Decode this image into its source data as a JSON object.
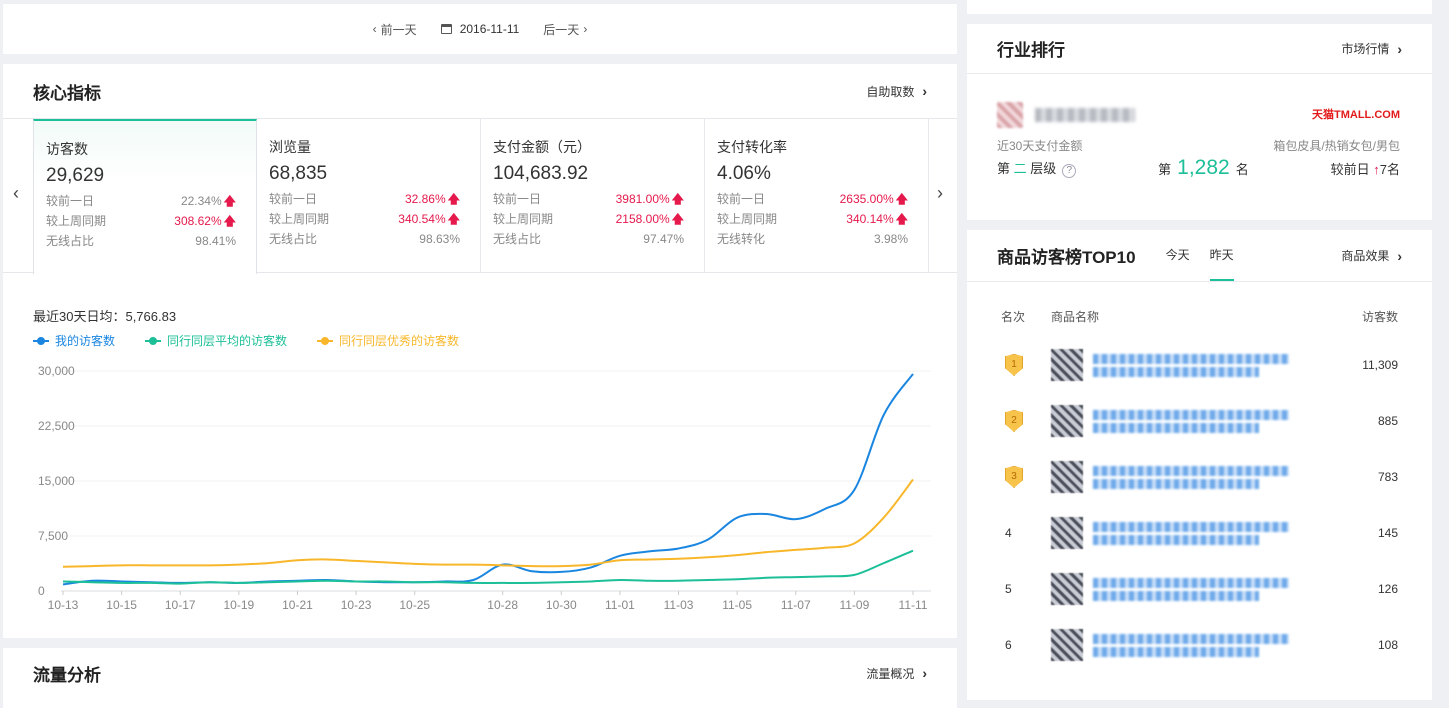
{
  "datebar": {
    "prev": "前一天",
    "date": "2016-11-11",
    "next": "后一天"
  },
  "core": {
    "title": "核心指标",
    "link": "自助取数",
    "metrics": [
      {
        "title": "访客数",
        "value": "29,629",
        "rows": [
          {
            "label": "较前一日",
            "value": "22.34%",
            "up": false
          },
          {
            "label": "较上周同期",
            "value": "308.62%",
            "up": true
          },
          {
            "label": "无线占比",
            "value": "98.41%",
            "up": null
          }
        ]
      },
      {
        "title": "浏览量",
        "value": "68,835",
        "rows": [
          {
            "label": "较前一日",
            "value": "32.86%",
            "up": true
          },
          {
            "label": "较上周同期",
            "value": "340.54%",
            "up": true
          },
          {
            "label": "无线占比",
            "value": "98.63%",
            "up": null
          }
        ]
      },
      {
        "title": "支付金额（元）",
        "value": "104,683.92",
        "rows": [
          {
            "label": "较前一日",
            "value": "3981.00%",
            "up": true
          },
          {
            "label": "较上周同期",
            "value": "2158.00%",
            "up": true
          },
          {
            "label": "无线占比",
            "value": "97.47%",
            "up": null
          }
        ]
      },
      {
        "title": "支付转化率",
        "value": "4.06%",
        "rows": [
          {
            "label": "较前一日",
            "value": "2635.00%",
            "up": true
          },
          {
            "label": "较上周同期",
            "value": "340.14%",
            "up": true
          },
          {
            "label": "无线转化",
            "value": "3.98%",
            "up": null
          }
        ]
      }
    ],
    "avg_label": "最近30天日均：5,766.83"
  },
  "chart_data": {
    "type": "line",
    "ylim": [
      0,
      30000
    ],
    "yticks": [
      "30,000",
      "22,500",
      "15,000",
      "7,500",
      "0"
    ],
    "ytick_values": [
      30000,
      22500,
      15000,
      7500,
      0
    ],
    "x": [
      "10-13",
      "10-14",
      "10-15",
      "10-16",
      "10-17",
      "10-18",
      "10-19",
      "10-20",
      "10-21",
      "10-22",
      "10-23",
      "10-24",
      "10-25",
      "10-26",
      "10-27",
      "10-28",
      "10-29",
      "10-30",
      "10-31",
      "11-01",
      "11-02",
      "11-03",
      "11-04",
      "11-05",
      "11-06",
      "11-07",
      "11-08",
      "11-09",
      "11-10",
      "11-11"
    ],
    "xtick_labels": [
      "10-13",
      "10-15",
      "10-17",
      "10-19",
      "10-21",
      "10-23",
      "10-25",
      "10-28",
      "10-30",
      "11-01",
      "11-03",
      "11-05",
      "11-07",
      "11-09",
      "11-11"
    ],
    "series": [
      {
        "name": "我的访客数",
        "color": "#1a86e0",
        "values": [
          900,
          1400,
          1300,
          1200,
          1100,
          1200,
          1100,
          1300,
          1400,
          1500,
          1300,
          1200,
          1200,
          1300,
          1500,
          3600,
          2700,
          2600,
          3200,
          4800,
          5400,
          5800,
          7000,
          10000,
          10500,
          9800,
          11200,
          13800,
          24000,
          29600
        ]
      },
      {
        "name": "同行同层平均的访客数",
        "color": "#1cbf98",
        "values": [
          1300,
          1200,
          1100,
          1100,
          1000,
          1200,
          1100,
          1200,
          1300,
          1400,
          1300,
          1300,
          1200,
          1200,
          1100,
          1100,
          1100,
          1200,
          1300,
          1500,
          1400,
          1400,
          1500,
          1600,
          1800,
          1900,
          2000,
          2200,
          3800,
          5500
        ]
      },
      {
        "name": "同行同层优秀的访客数",
        "color": "#f8b72a",
        "values": [
          3300,
          3400,
          3500,
          3500,
          3500,
          3500,
          3600,
          3800,
          4200,
          4300,
          4100,
          3900,
          3700,
          3600,
          3600,
          3500,
          3400,
          3400,
          3600,
          4200,
          4300,
          4400,
          4600,
          4900,
          5300,
          5600,
          5900,
          6500,
          10000,
          15200
        ]
      }
    ]
  },
  "flow": {
    "title": "流量分析",
    "link": "流量概况"
  },
  "rank": {
    "title": "行业排行",
    "link": "市场行情",
    "tmall": "天猫TMALL.COM",
    "sub_left": "近30天支付金额",
    "sub_right": "箱包皮具/热销女包/男包",
    "level_prefix": "第",
    "level_num": "二",
    "level_suffix": "层级",
    "rank_prefix": "第",
    "rank_num": "1,282",
    "rank_suffix": "名",
    "prev_prefix": "较前日",
    "prev_value": "7名"
  },
  "top10": {
    "title": "商品访客榜TOP10",
    "tabs": [
      "今天",
      "昨天"
    ],
    "active_tab": 1,
    "link": "商品效果",
    "head": {
      "rank": "名次",
      "name": "商品名称",
      "visitors": "访客数"
    },
    "rows": [
      {
        "rank": "1",
        "visitors": "11,309",
        "badge": true
      },
      {
        "rank": "2",
        "visitors": "885",
        "badge": true
      },
      {
        "rank": "3",
        "visitors": "783",
        "badge": true
      },
      {
        "rank": "4",
        "visitors": "145",
        "badge": false
      },
      {
        "rank": "5",
        "visitors": "126",
        "badge": false
      },
      {
        "rank": "6",
        "visitors": "108",
        "badge": false
      }
    ]
  }
}
